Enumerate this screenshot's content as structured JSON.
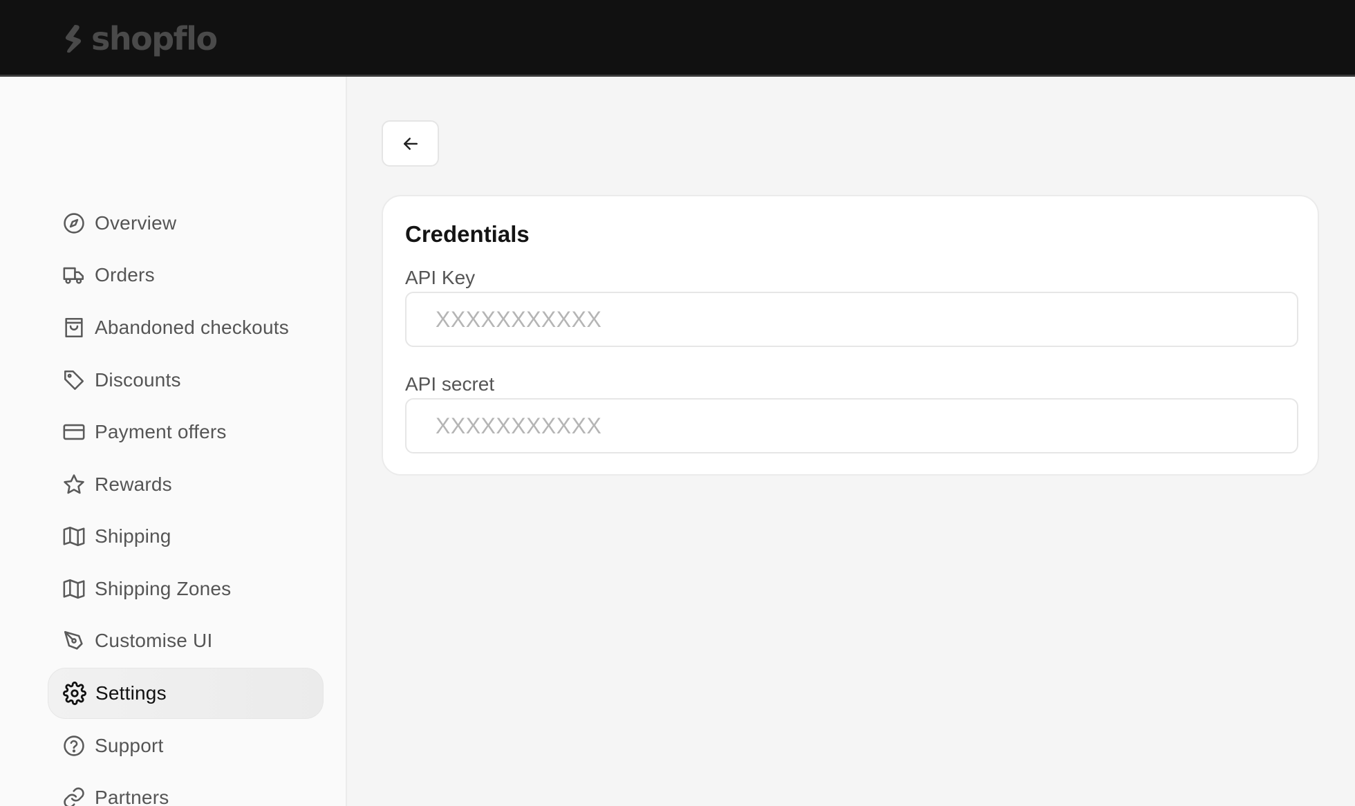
{
  "brand": {
    "name": "shopflo"
  },
  "sidebar": {
    "items": [
      {
        "label": "Overview",
        "icon": "compass-icon"
      },
      {
        "label": "Orders",
        "icon": "truck-icon"
      },
      {
        "label": "Abandoned checkouts",
        "icon": "shopping-bag-icon"
      },
      {
        "label": "Discounts",
        "icon": "tag-icon"
      },
      {
        "label": "Payment offers",
        "icon": "credit-card-icon"
      },
      {
        "label": "Rewards",
        "icon": "star-icon"
      },
      {
        "label": "Shipping",
        "icon": "map-icon"
      },
      {
        "label": "Shipping Zones",
        "icon": "map-icon"
      },
      {
        "label": "Customise UI",
        "icon": "pen-tool-icon"
      },
      {
        "label": "Settings",
        "icon": "gear-icon",
        "active": true
      },
      {
        "label": "Support",
        "icon": "help-circle-icon"
      },
      {
        "label": "Partners",
        "icon": "link-icon"
      }
    ]
  },
  "main": {
    "back_button": {
      "icon": "arrow-left-icon"
    },
    "card": {
      "title": "Credentials",
      "fields": [
        {
          "label": "API Key",
          "value": "",
          "placeholder": "XXXXXXXXXXX"
        },
        {
          "label": "API secret",
          "value": "",
          "placeholder": "XXXXXXXXXXX"
        }
      ]
    }
  },
  "colors": {
    "topbar_bg": "#111111",
    "page_bg": "#f5f5f5",
    "sidebar_bg": "#fafafa",
    "active_item_bg": "#eeeeee",
    "text_primary": "#111111",
    "text_secondary": "#555555"
  }
}
